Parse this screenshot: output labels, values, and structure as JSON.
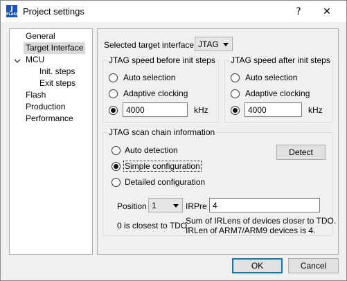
{
  "window": {
    "title": "Project settings",
    "help_label": "?",
    "close_label": "✕",
    "app_icon_text": "J",
    "app_icon_subtext": "FLASH"
  },
  "tree": {
    "items": [
      {
        "label": "General"
      },
      {
        "label": "Target Interface"
      },
      {
        "label": "MCU"
      },
      {
        "label": "Init. steps"
      },
      {
        "label": "Exit steps"
      },
      {
        "label": "Flash"
      },
      {
        "label": "Production"
      },
      {
        "label": "Performance"
      }
    ],
    "selected": "Target Interface"
  },
  "target": {
    "label": "Selected target interface:",
    "value": "JTAG"
  },
  "speed_before": {
    "title": "JTAG speed before init steps",
    "auto": "Auto selection",
    "adaptive": "Adaptive clocking",
    "value": "4000",
    "unit": "kHz",
    "selected": "custom"
  },
  "speed_after": {
    "title": "JTAG speed after init steps",
    "auto": "Auto selection",
    "adaptive": "Adaptive clocking",
    "value": "4000",
    "unit": "kHz",
    "selected": "custom"
  },
  "scan_chain": {
    "title": "JTAG scan chain information",
    "auto_detection": "Auto detection",
    "simple": "Simple configuration",
    "detailed": "Detailed configuration",
    "detect_button": "Detect",
    "selected": "simple",
    "position_label": "Position",
    "position_value": "1",
    "irpre_label": "IRPre",
    "irpre_value": "4",
    "position_hint": "0 is closest to TDO.",
    "irpre_hint_1": "Sum of IRLens of devices closer to TDO.",
    "irpre_hint_2": "IRLen of ARM7/ARM9 devices is 4."
  },
  "buttons": {
    "ok": "OK",
    "cancel": "Cancel"
  }
}
